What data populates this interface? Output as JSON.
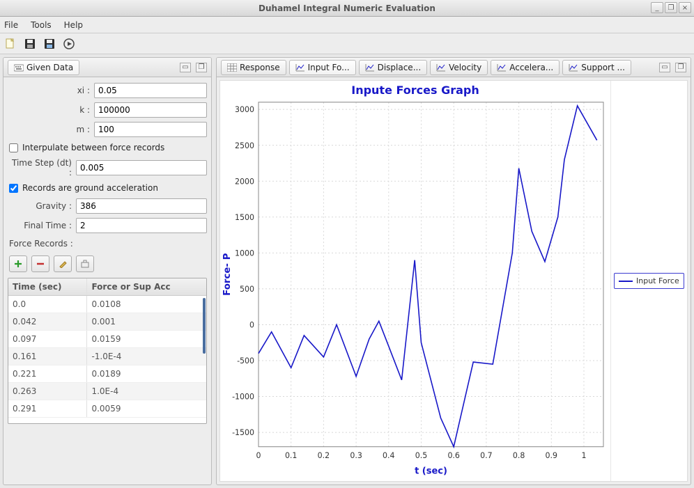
{
  "window": {
    "title": "Duhamel Integral Numeric Evaluation"
  },
  "menu": {
    "file": "File",
    "tools": "Tools",
    "help": "Help"
  },
  "sidebar": {
    "title": "Given Data",
    "fields": {
      "xi_label": "xi :",
      "xi": "0.05",
      "k_label": "k :",
      "k": "100000",
      "m_label": "m :",
      "m": "100",
      "interp_label": "Interpulate between force records",
      "dt_label": "Time Step (dt) :",
      "dt": "0.005",
      "ground_label": "Records are ground acceleration",
      "gravity_label": "Gravity :",
      "gravity": "386",
      "final_label": "Final Time :",
      "final": "2",
      "records_label": "Force Records :"
    },
    "table": {
      "col_time": "Time (sec)",
      "col_force": "Force or Sup Acc",
      "rows": [
        {
          "t": "0.0",
          "f": "0.0108"
        },
        {
          "t": "0.042",
          "f": "0.001"
        },
        {
          "t": "0.097",
          "f": "0.0159"
        },
        {
          "t": "0.161",
          "f": "-1.0E-4"
        },
        {
          "t": "0.221",
          "f": "0.0189"
        },
        {
          "t": "0.263",
          "f": "1.0E-4"
        },
        {
          "t": "0.291",
          "f": "0.0059"
        }
      ]
    }
  },
  "tabs": [
    {
      "label": "Response",
      "active": false,
      "icon": "grid"
    },
    {
      "label": "Input Fo...",
      "active": true,
      "icon": "chart"
    },
    {
      "label": "Displace...",
      "active": false,
      "icon": "chart"
    },
    {
      "label": "Velocity",
      "active": false,
      "icon": "chart"
    },
    {
      "label": "Accelera...",
      "active": false,
      "icon": "chart"
    },
    {
      "label": "Support ...",
      "active": false,
      "icon": "chart"
    }
  ],
  "chart_data": {
    "type": "line",
    "title": "Inpute Forces Graph",
    "xlabel": "t (sec)",
    "ylabel": "Force- P",
    "legend": "Input Force",
    "xlim": [
      0,
      1.06
    ],
    "ylim": [
      -1700,
      3100
    ],
    "xticks": [
      0,
      0.1,
      0.2,
      0.3,
      0.4,
      0.5,
      0.6,
      0.7,
      0.8,
      0.9,
      1
    ],
    "yticks": [
      -1500,
      -1000,
      -500,
      0,
      500,
      1000,
      1500,
      2000,
      2500,
      3000
    ],
    "series": [
      {
        "name": "Input Force",
        "points": [
          [
            0.0,
            -400
          ],
          [
            0.04,
            -100
          ],
          [
            0.1,
            -600
          ],
          [
            0.14,
            -150
          ],
          [
            0.2,
            -450
          ],
          [
            0.24,
            0
          ],
          [
            0.3,
            -720
          ],
          [
            0.34,
            -200
          ],
          [
            0.37,
            50
          ],
          [
            0.4,
            -300
          ],
          [
            0.44,
            -770
          ],
          [
            0.48,
            900
          ],
          [
            0.5,
            -250
          ],
          [
            0.56,
            -1300
          ],
          [
            0.6,
            -1700
          ],
          [
            0.66,
            -520
          ],
          [
            0.72,
            -550
          ],
          [
            0.78,
            1000
          ],
          [
            0.8,
            2180
          ],
          [
            0.84,
            1300
          ],
          [
            0.88,
            880
          ],
          [
            0.92,
            1500
          ],
          [
            0.94,
            2300
          ],
          [
            0.98,
            3050
          ],
          [
            1.04,
            2570
          ]
        ]
      }
    ]
  }
}
